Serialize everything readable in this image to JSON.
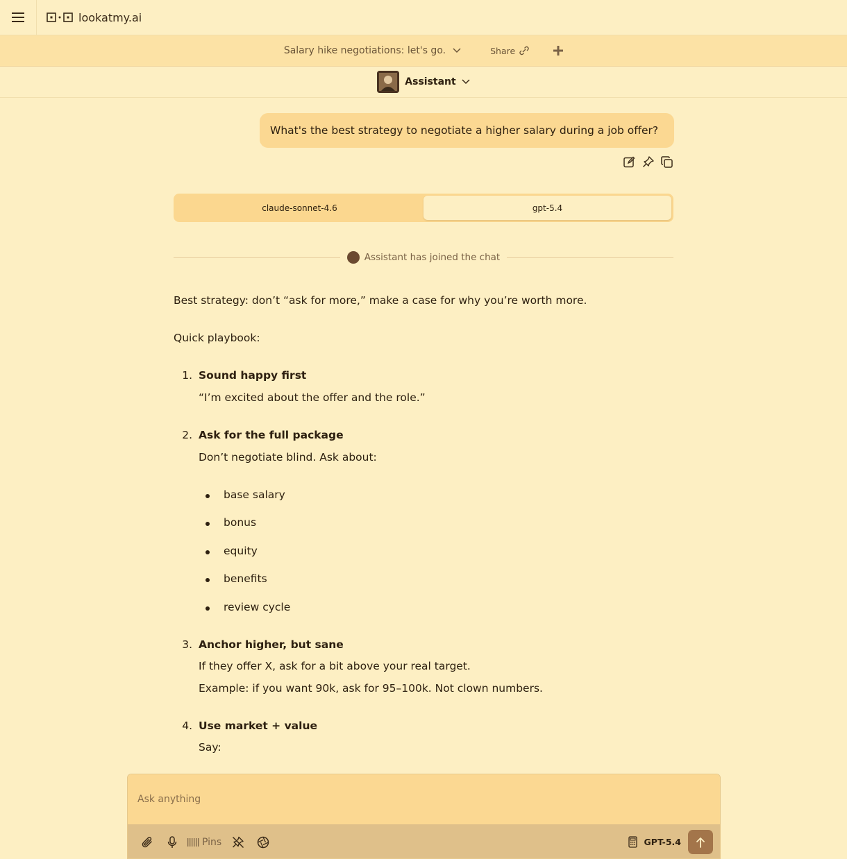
{
  "app": {
    "name": "lookatmy.ai"
  },
  "conversation": {
    "title": "Salary hike negotiations: let's go.",
    "share_label": "Share"
  },
  "assistant": {
    "name": "Assistant"
  },
  "user_message": "What's the best strategy to negotiate a higher salary during a job offer?",
  "model_tabs": [
    {
      "label": "claude-sonnet-4.6",
      "active": false
    },
    {
      "label": "gpt-5.4",
      "active": true
    }
  ],
  "joined_text": "Assistant has joined the chat",
  "response": {
    "intro": "Best strategy: don’t “ask for more,” make a case for why you’re worth more.",
    "playbook_heading": "Quick playbook:",
    "steps": [
      {
        "number": "1.",
        "title": "Sound happy first",
        "lines": [
          "“I’m excited about the offer and the role.”"
        ]
      },
      {
        "number": "2.",
        "title": "Ask for the full package",
        "lines": [
          "Don’t negotiate blind. Ask about:"
        ],
        "bullets": [
          "base salary",
          "bonus",
          "equity",
          "benefits",
          "review cycle"
        ]
      },
      {
        "number": "3.",
        "title": "Anchor higher, but sane",
        "lines": [
          "If they offer X, ask for a bit above your real target.",
          "Example: if you want 90k, ask for 95–100k. Not clown numbers."
        ]
      },
      {
        "number": "4.",
        "title": "Use market + value",
        "lines": [
          "Say:"
        ]
      }
    ]
  },
  "composer": {
    "placeholder": "Ask anything",
    "pins_label": "Pins",
    "model_label": "GPT-5.4"
  },
  "colors": {
    "background": "#fdefc3",
    "accent": "#fbd892",
    "send_button": "#a3754a"
  }
}
